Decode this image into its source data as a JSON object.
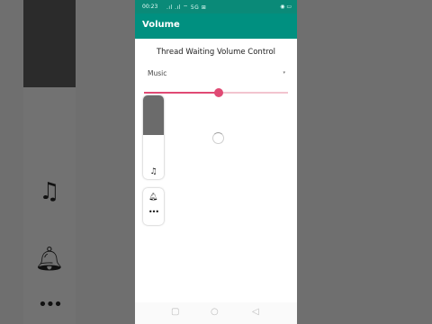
{
  "status_bar": {
    "time": "00:23",
    "icons": ".ıl .ıl ⌔ 5G ⊞",
    "battery": "◉ ▭"
  },
  "app_bar": {
    "title": "Volume"
  },
  "main": {
    "control_title": "Thread Waiting Volume Control",
    "stream_select": {
      "value": "Music",
      "arrow": "▾"
    },
    "volume_level_fraction": 0.52
  },
  "volume_panel": {
    "level_fraction": 0.53,
    "stream_icon": "music-note-icon",
    "ring_icon": "bell-icon",
    "more_icon": "more-icon"
  },
  "nav_bar": {
    "icons": [
      "recents-icon",
      "home-icon",
      "back-icon"
    ]
  },
  "colors": {
    "app_bar": "#009080",
    "status_bar": "#0a8a78",
    "accent": "#e04a74"
  }
}
